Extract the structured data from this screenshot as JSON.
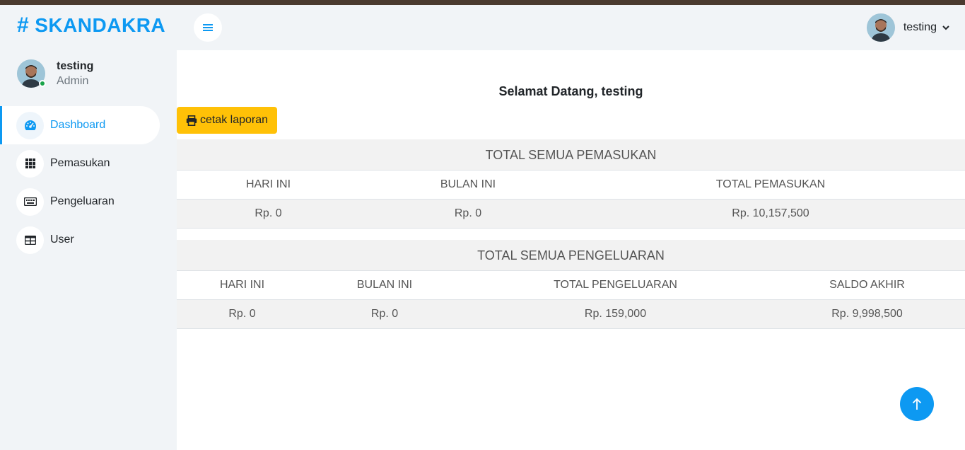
{
  "brand": {
    "hash": "#",
    "name": "SKANDAKRA"
  },
  "profile": {
    "name": "testing",
    "role": "Admin"
  },
  "nav": [
    {
      "label": "Dashboard",
      "icon": "speedometer-icon",
      "active": true
    },
    {
      "label": "Pemasukan",
      "icon": "grid-icon",
      "active": false
    },
    {
      "label": "Pengeluaran",
      "icon": "keyboard-icon",
      "active": false
    },
    {
      "label": "User",
      "icon": "table-icon",
      "active": false
    }
  ],
  "header": {
    "user_name": "testing"
  },
  "main": {
    "welcome": "Selamat Datang, testing",
    "print_label": "cetak laporan",
    "income": {
      "title": "TOTAL SEMUA PEMASUKAN",
      "columns": [
        "HARI INI",
        "BULAN INI",
        "TOTAL PEMASUKAN"
      ],
      "values": [
        "Rp. 0",
        "Rp. 0",
        "Rp. 10,157,500"
      ]
    },
    "expense": {
      "title": "TOTAL SEMUA PENGELUARAN",
      "columns": [
        "HARI INI",
        "BULAN INI",
        "TOTAL PENGELUARAN",
        "SALDO AKHIR"
      ],
      "values": [
        "Rp. 0",
        "Rp. 0",
        "Rp. 159,000",
        "Rp. 9,998,500"
      ]
    }
  },
  "colors": {
    "primary": "#0d99f2",
    "warning": "#ffc107",
    "online": "#1aa34a"
  }
}
